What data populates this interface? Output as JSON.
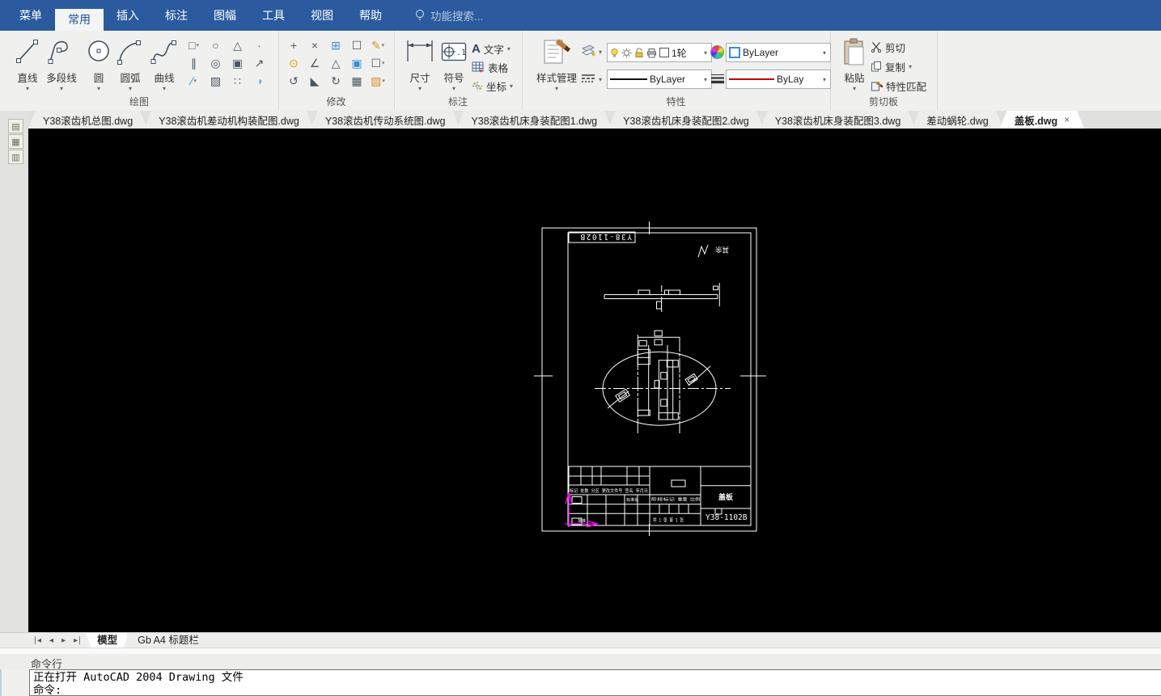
{
  "menu": {
    "items": [
      {
        "label": "菜单"
      },
      {
        "label": "常用",
        "cls": "active"
      },
      {
        "label": "插入"
      },
      {
        "label": "标注"
      },
      {
        "label": "图幅"
      },
      {
        "label": "工具"
      },
      {
        "label": "视图"
      },
      {
        "label": "帮助"
      }
    ],
    "search_label": "功能搜索..."
  },
  "ribbon": {
    "panel_labels": {
      "draw": "绘图",
      "modify": "修改",
      "annotate": "标注",
      "properties": "特性",
      "clipboard": "剪切板"
    },
    "draw": {
      "tools": [
        {
          "label": "直线"
        },
        {
          "label": "多段线"
        },
        {
          "label": "圆"
        },
        {
          "label": "圆弧"
        },
        {
          "label": "曲线"
        }
      ],
      "small": [
        {
          "n": "rectangle-icon",
          "g": "□",
          "ar": "▾"
        },
        {
          "n": "ellipse-icon",
          "g": "○"
        },
        {
          "n": "revision-arc-icon",
          "g": "△"
        },
        {
          "n": "point-icon",
          "g": "·"
        },
        {
          "n": "parallel-lines-icon",
          "g": "∥"
        },
        {
          "n": "donut-icon",
          "g": "◎"
        },
        {
          "n": "block-icon",
          "g": "▣"
        },
        {
          "n": "pointer-icon",
          "g": "↗"
        },
        {
          "n": "construction-line-icon",
          "g": "∕",
          "ar": "▾",
          "c": "#3b8de0"
        },
        {
          "n": "hatch-icon",
          "g": "▨"
        },
        {
          "n": "group-icon",
          "g": "∷"
        },
        {
          "n": "wipeout-icon",
          "g": "◑",
          "c": "#7ab0d4"
        }
      ]
    },
    "modify": {
      "small": [
        {
          "n": "move-icon",
          "g": "+"
        },
        {
          "n": "trim-icon",
          "g": "×"
        },
        {
          "n": "array-icon",
          "g": "⊞",
          "c": "#3b8de0"
        },
        {
          "n": "stretch-icon",
          "g": "☐"
        },
        {
          "n": "erase-icon",
          "g": "✎",
          "ar": "▾",
          "c": "#d98e2b"
        },
        {
          "n": "copy-icon",
          "g": "⊙",
          "c": "#d9a400"
        },
        {
          "n": "extend-icon",
          "g": "∠"
        },
        {
          "n": "mirror-icon",
          "g": "△"
        },
        {
          "n": "overlap-icon",
          "g": "▣",
          "c": "#3b8de0"
        },
        {
          "n": "scale-icon",
          "g": "☐",
          "ar": "▾"
        },
        {
          "n": "offset-icon",
          "g": "↺"
        },
        {
          "n": "chamfer-icon",
          "g": "◣"
        },
        {
          "n": "rotate-icon",
          "g": "↻"
        },
        {
          "n": "box-3d-icon",
          "g": "▦"
        },
        {
          "n": "hatch-edit-icon",
          "g": "▨",
          "ar": "▾",
          "c": "#d98e2b"
        }
      ]
    },
    "annotate": {
      "dimension": "尺寸",
      "symbol": "符号",
      "text_glyph": "A",
      "text": "文字",
      "table": "表格",
      "coordinate": "坐标"
    },
    "properties": {
      "style_manager": "样式管理",
      "layer_value": "1轮",
      "color_value": "ByLayer",
      "linetype_value": "ByLayer",
      "lineweight_value": "ByLay"
    },
    "clipboard": {
      "paste": "粘贴",
      "cut": "剪切",
      "copy": "复制",
      "match": "特性匹配"
    }
  },
  "doc_tabs": [
    {
      "label": "Y38滚齿机总图.dwg"
    },
    {
      "label": "Y38滚齿机差动机构装配图.dwg"
    },
    {
      "label": "Y38滚齿机传动系统图.dwg"
    },
    {
      "label": "Y38滚齿机床身装配图1.dwg"
    },
    {
      "label": "Y38滚齿机床身装配图2.dwg"
    },
    {
      "label": "Y38滚齿机床身装配图3.dwg"
    },
    {
      "label": "差动蜗轮.dwg"
    },
    {
      "label": "盖板.dwg",
      "cls": "active",
      "close": "×"
    }
  ],
  "drawing": {
    "sheet_no": "Y38-1102B",
    "part_name": "盖板",
    "roughness_label": "其余",
    "rev_header": "标记 处数 分区 更改文件号 签名 年月日",
    "cells": {
      "standardization": "标准化",
      "approve": "批准",
      "stage": "阶段标记",
      "weight": "重量",
      "scale": "比例",
      "sheets": "共 1 张 第 1 张"
    }
  },
  "layout_tabs": {
    "nav": [
      "∣◂",
      "◂",
      "▸",
      "▸∣"
    ],
    "model": "模型",
    "layout1": "Gb A4 标题栏"
  },
  "command": {
    "title": "命令行",
    "lines": [
      "正在打开 AutoCAD 2004 Drawing 文件",
      "命令:"
    ]
  }
}
